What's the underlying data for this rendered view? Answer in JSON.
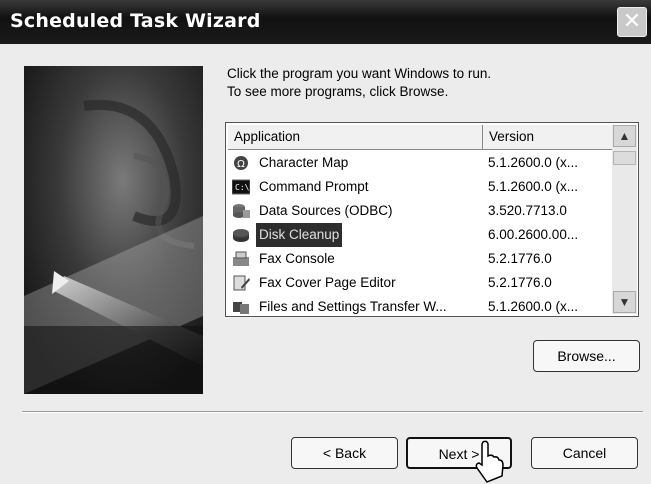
{
  "window": {
    "title": "Scheduled Task Wizard",
    "close_glyph": "✕"
  },
  "instructions": {
    "line1": "Click the program you want Windows to run.",
    "line2": "To see more programs, click Browse."
  },
  "list": {
    "columns": [
      "Application",
      "Version"
    ],
    "rows": [
      {
        "name": "Character Map",
        "version": "5.1.2600.0 (x...",
        "icon": "character-map-icon",
        "selected": false
      },
      {
        "name": "Command Prompt",
        "version": "5.1.2600.0 (x...",
        "icon": "command-prompt-icon",
        "selected": false
      },
      {
        "name": "Data Sources (ODBC)",
        "version": "3.520.7713.0",
        "icon": "data-sources-icon",
        "selected": false
      },
      {
        "name": "Disk Cleanup",
        "version": "6.00.2600.00...",
        "icon": "disk-cleanup-icon",
        "selected": true
      },
      {
        "name": "Fax Console",
        "version": "5.2.1776.0",
        "icon": "fax-console-icon",
        "selected": false
      },
      {
        "name": "Fax Cover Page Editor",
        "version": "5.2.1776.0",
        "icon": "fax-cover-page-icon",
        "selected": false
      },
      {
        "name": "Files and Settings Transfer W...",
        "version": "5.1.2600.0 (x...",
        "icon": "files-settings-transfer-icon",
        "selected": false
      }
    ]
  },
  "buttons": {
    "browse": "Browse...",
    "back": "< Back",
    "next": "Next >",
    "cancel": "Cancel"
  },
  "scrollbar": {
    "up_glyph": "▲",
    "down_glyph": "▼"
  }
}
